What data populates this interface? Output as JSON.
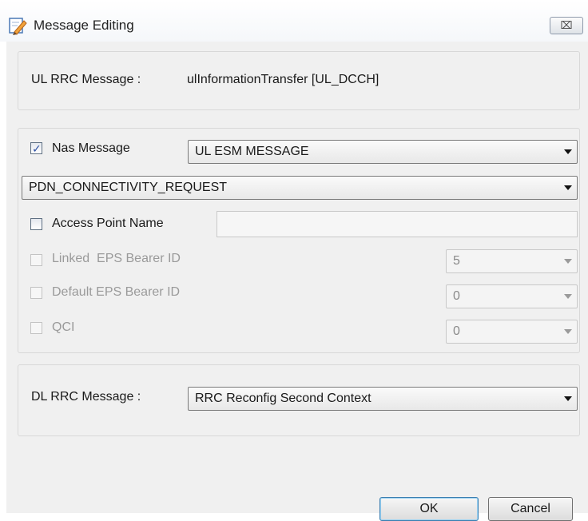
{
  "window": {
    "title": "Message Editing",
    "close_label": "⌧"
  },
  "ul_rrc": {
    "label": "UL RRC Message :",
    "value": "ulInformationTransfer [UL_DCCH]"
  },
  "nas": {
    "checkbox_label": "Nas Message",
    "checked": true,
    "message_type": "UL ESM MESSAGE",
    "procedure": "PDN_CONNECTIVITY_REQUEST",
    "apn": {
      "checkbox_label": "Access Point Name",
      "checked": false,
      "value": ""
    },
    "linked_eps": {
      "checkbox_label": "Linked  EPS Bearer ID",
      "value": "5"
    },
    "default_eps": {
      "checkbox_label": "Default EPS Bearer ID",
      "value": "0"
    },
    "qci": {
      "checkbox_label": "QCI",
      "value": "0"
    }
  },
  "dl_rrc": {
    "label": "DL RRC Message :",
    "value": "RRC Reconfig Second Context"
  },
  "buttons": {
    "ok": "OK",
    "cancel": "Cancel"
  }
}
